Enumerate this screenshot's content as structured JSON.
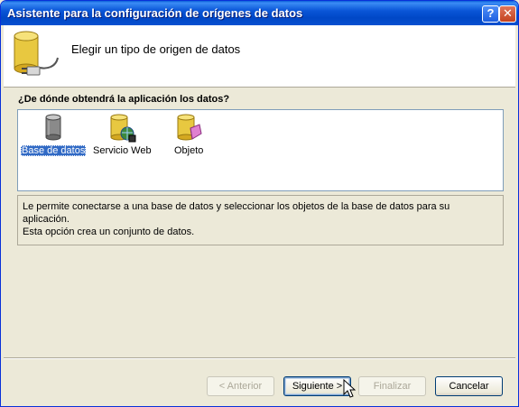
{
  "window": {
    "title": "Asistente para la configuración de orígenes de datos",
    "help_label": "?",
    "close_label": "✕"
  },
  "header": {
    "title": "Elegir un tipo de origen de datos",
    "icon": "database-plug-icon"
  },
  "question": "¿De dónde obtendrá la aplicación los datos?",
  "sources": [
    {
      "label": "Base de datos",
      "icon": "database-icon",
      "selected": true
    },
    {
      "label": "Servicio Web",
      "icon": "web-service-icon",
      "selected": false
    },
    {
      "label": "Objeto",
      "icon": "object-icon",
      "selected": false
    }
  ],
  "description": {
    "line1": "Le permite conectarse a una base de datos y seleccionar los objetos de la base de datos para su aplicación.",
    "line2": "Esta opción crea un conjunto de datos."
  },
  "buttons": {
    "back": "< Anterior",
    "next": "Siguiente >",
    "finish": "Finalizar",
    "cancel": "Cancelar"
  },
  "colors": {
    "titlebar": "#0a56d8",
    "selection": "#316ac5",
    "face": "#ece9d8"
  }
}
